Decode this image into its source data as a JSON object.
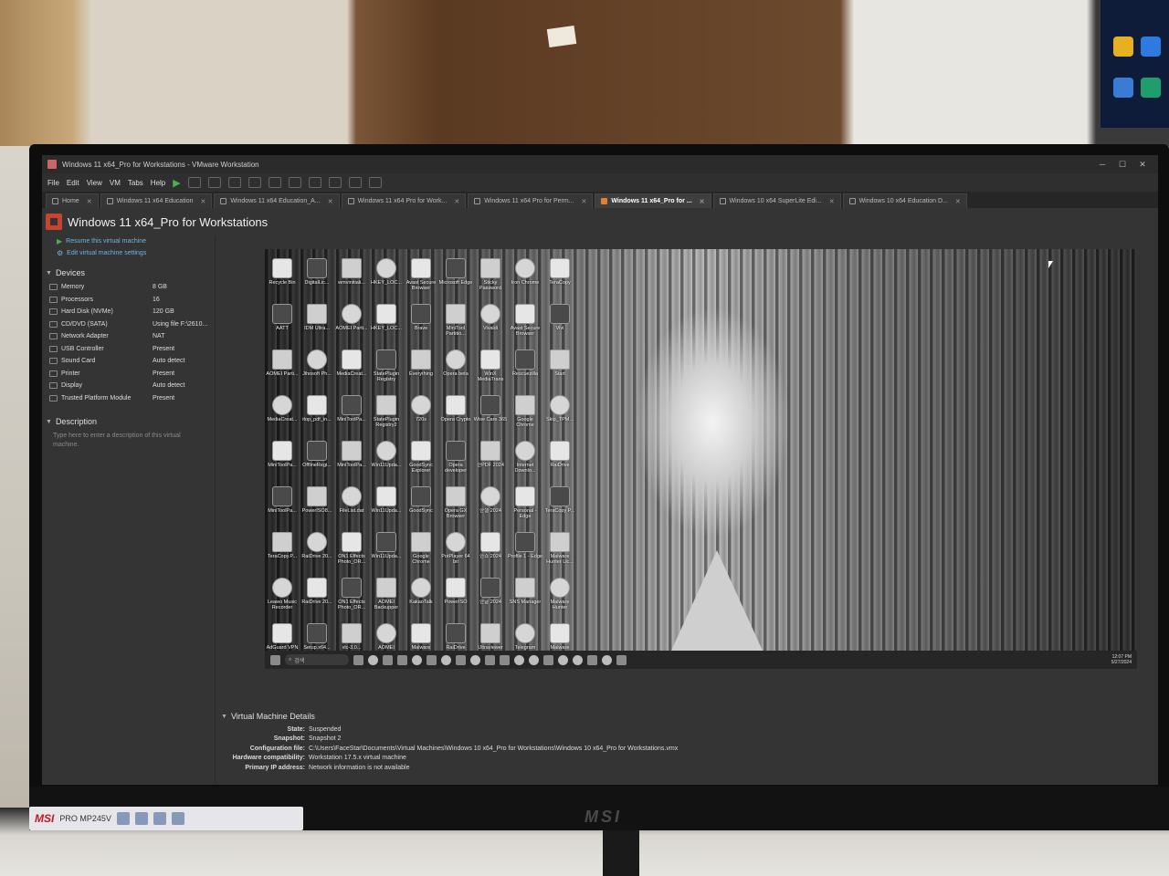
{
  "window": {
    "title": "Windows 11 x64_Pro for Workstations - VMware Workstation",
    "minimize": "─",
    "maximize": "☐",
    "close": "✕"
  },
  "menu": [
    "File",
    "Edit",
    "View",
    "VM",
    "Tabs",
    "Help"
  ],
  "tabs": [
    {
      "label": "Home",
      "active": false
    },
    {
      "label": "Windows 11 x64 Education",
      "active": false
    },
    {
      "label": "Windows 11 x64 Education_A...",
      "active": false
    },
    {
      "label": "Windows 11 x64 Pro for Work...",
      "active": false
    },
    {
      "label": "Windows 11 x64 Pro for Perm...",
      "active": false
    },
    {
      "label": "Windows 11 x64_Pro for ...",
      "active": true
    },
    {
      "label": "Windows 10 x64 SuperLite Edi...",
      "active": false
    },
    {
      "label": "Windows 10 x64 Education D...",
      "active": false
    }
  ],
  "vm": {
    "name": "Windows 11 x64_Pro for Workstations",
    "actions": {
      "resume": "Resume this virtual machine",
      "edit": "Edit virtual machine settings"
    }
  },
  "devices": {
    "heading": "Devices",
    "items": [
      {
        "name": "Memory",
        "value": "8 GB"
      },
      {
        "name": "Processors",
        "value": "16"
      },
      {
        "name": "Hard Disk (NVMe)",
        "value": "120 GB"
      },
      {
        "name": "CD/DVD (SATA)",
        "value": "Using file F:\\2610..."
      },
      {
        "name": "Network Adapter",
        "value": "NAT"
      },
      {
        "name": "USB Controller",
        "value": "Present"
      },
      {
        "name": "Sound Card",
        "value": "Auto detect"
      },
      {
        "name": "Printer",
        "value": "Present"
      },
      {
        "name": "Display",
        "value": "Auto detect"
      },
      {
        "name": "Trusted Platform Module",
        "value": "Present"
      }
    ]
  },
  "description": {
    "heading": "Description",
    "placeholder": "Type here to enter a description of this virtual machine."
  },
  "guest": {
    "desktop_icons": [
      "Recycle Bin",
      "DigitalLic...",
      "wmvinitiali...",
      "HKEY_LOC...",
      "Avast Secure Browser",
      "Microsoft Edge",
      "Sticky Password",
      "Iron Chrome",
      "TeraCopy",
      "AATT",
      "IDM Ultra...",
      "AOMEI Parti...",
      "HKEY_LOC...",
      "Brave",
      "MiniTool Partitio...",
      "Vivaldi",
      "Avast Secure Browser",
      "Vivi",
      "AOMEI Parti...",
      "Jihosoft Ph...",
      "MediaCreat...",
      "StatePlugin Registry",
      "Everything",
      "Opera beta",
      "WinX MediaTrans",
      "Rescuezilla",
      "Start",
      "MediaCreat...",
      "itop_pdf_in...",
      "MiniToolPa...",
      "StatePlugin Registry2",
      "720s",
      "Opera Crypto",
      "Wise Care 365",
      "Google Chrome",
      "Skip_TPM...",
      "MiniToolPa...",
      "OfflineRegi...",
      "MiniToolPa...",
      "Win11Upda...",
      "GoodSync Explorer",
      "Opera developer",
      "한PDF 2024",
      "Internet Downlo...",
      "RaiDrive",
      "MiniToolPa...",
      "PowerISO8...",
      "FileList.dat",
      "Win11Upda...",
      "GoodSync",
      "Opera GX Browser",
      "한셀 2024",
      "Personal - Edge",
      "TeraCopy P...",
      "TeraCopy.P...",
      "RaiDrive 20...",
      "ON1 Effects Photo_OR...",
      "Win11Upda...",
      "Google Chrome",
      "PotPlayer 64 bit",
      "한쇼 2024",
      "Profile 1 - Edge",
      "Malware Hunter Lic...",
      "Leawo Music Recorder",
      "RaiDrive 20...",
      "ON1 Effects Photo_OR...",
      "AOMEI Backupper",
      "KakaoTalk",
      "PowerISO",
      "한글 2024",
      "SNS Manager",
      "Malware Hunter",
      "AdGuard VPN",
      "Setup.x64...",
      "vlc-3.0...",
      "AOMEI Partitio...",
      "Malware Hunter",
      "RaiDrive",
      "Ultraviewer",
      "Telegram",
      "Malware Hunter Lic..."
    ],
    "search_label": "검색",
    "time": "12:07 PM",
    "date": "5/27/2024"
  },
  "details": {
    "heading": "Virtual Machine Details",
    "rows": [
      {
        "label": "State:",
        "value": "Suspended"
      },
      {
        "label": "Snapshot:",
        "value": "Snapshot 2"
      },
      {
        "label": "Configuration file:",
        "value": "C:\\Users\\FaceStar\\Documents\\Virtual Machines\\Windows 10 x64_Pro for Workstations\\Windows 10 x64_Pro for Workstations.vmx"
      },
      {
        "label": "Hardware compatibility:",
        "value": "Workstation 17.5.x virtual machine"
      },
      {
        "label": "Primary IP address:",
        "value": "Network information is not available"
      }
    ]
  },
  "monitor": {
    "brand": "MSI",
    "sticker_brand": "MSI",
    "sticker_model": "PRO MP245V"
  }
}
